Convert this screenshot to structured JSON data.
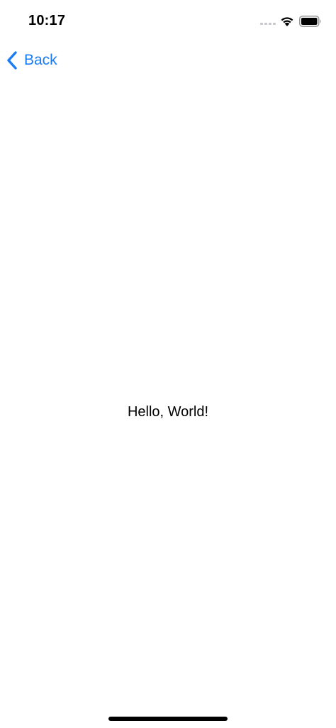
{
  "status_bar": {
    "time": "10:17",
    "signal_icon": "cellular-signal-icon",
    "wifi_icon": "wifi-icon",
    "battery_icon": "battery-icon",
    "battery_level": 1.0
  },
  "nav": {
    "back_label": "Back",
    "back_icon": "chevron-left-icon",
    "accent_color": "#1a7cf5"
  },
  "main": {
    "text": "Hello, World!"
  }
}
